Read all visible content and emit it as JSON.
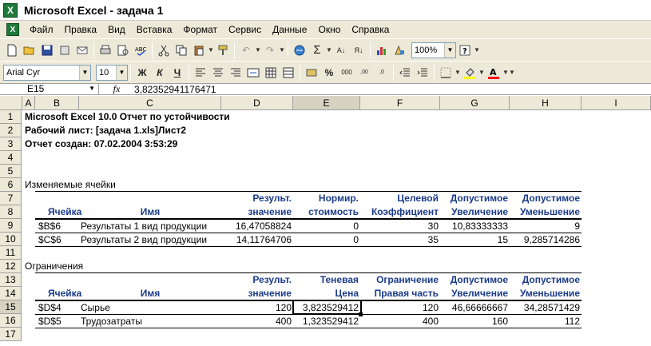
{
  "window": {
    "title": "Microsoft Excel - задача 1"
  },
  "menu": [
    "Файл",
    "Правка",
    "Вид",
    "Вставка",
    "Формат",
    "Сервис",
    "Данные",
    "Окно",
    "Справка"
  ],
  "toolbar": {
    "zoom": "100%",
    "font": "Arial Cyr",
    "size": "10",
    "bold": "Ж",
    "italic": "К",
    "underline": "Ч"
  },
  "formula_bar": {
    "cell_ref": "E15",
    "fx": "fx",
    "value": "3,82352941176471"
  },
  "columns": [
    "A",
    "B",
    "C",
    "D",
    "E",
    "F",
    "G",
    "H",
    "I"
  ],
  "rows": [
    "1",
    "2",
    "3",
    "4",
    "5",
    "6",
    "7",
    "8",
    "9",
    "10",
    "11",
    "12",
    "13",
    "14",
    "15",
    "16",
    "17"
  ],
  "sheet": {
    "r1": "Microsoft Excel 10.0 Отчет по устойчивости",
    "r2": "Рабочий лист: [задача 1.xls]Лист2",
    "r3": "Отчет создан: 07.02.2004 3:53:29",
    "r6": "Изменяемые ячейки",
    "t1_h7": [
      "Результ.",
      "Нормир.",
      "Целевой",
      "Допустимое",
      "Допустимое"
    ],
    "t1_h8": [
      "Ячейка",
      "Имя",
      "значение",
      "стоимость",
      "Коэффициент",
      "Увеличение",
      "Уменьшение"
    ],
    "t1_rows": [
      [
        "$B$6",
        "Результаты 1 вид продукции",
        "16,47058824",
        "0",
        "30",
        "10,83333333",
        "9"
      ],
      [
        "$C$6",
        "Результаты 2 вид продукции",
        "14,11764706",
        "0",
        "35",
        "15",
        "9,285714286"
      ]
    ],
    "r12": "Ограничения",
    "t2_h13": [
      "Результ.",
      "Теневая",
      "Ограничение",
      "Допустимое",
      "Допустимое"
    ],
    "t2_h14": [
      "Ячейка",
      "Имя",
      "значение",
      "Цена",
      "Правая часть",
      "Увеличение",
      "Уменьшение"
    ],
    "t2_rows": [
      [
        "$D$4",
        "Сырье",
        "120",
        "3,823529412",
        "120",
        "46,66666667",
        "34,28571429"
      ],
      [
        "$D$5",
        "Трудозатраты",
        "400",
        "1,323529412",
        "400",
        "160",
        "112"
      ]
    ]
  }
}
